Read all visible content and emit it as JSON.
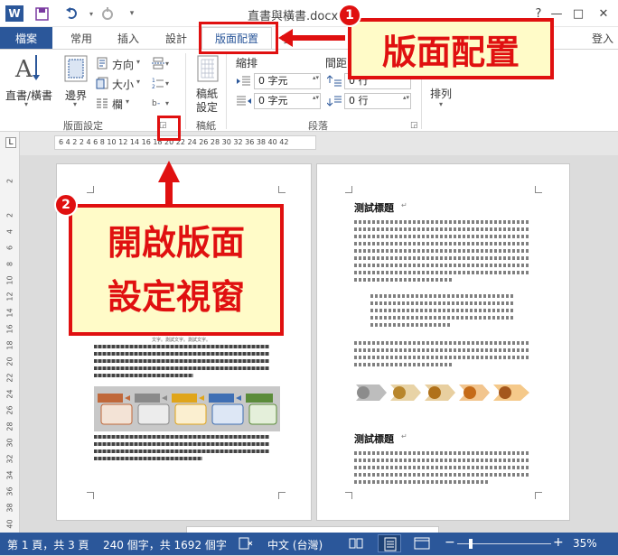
{
  "titlebar": {
    "doc_title": "直書與橫書.docx -",
    "app_icon": "W",
    "save_icon": "save-icon",
    "undo_icon": "undo-icon",
    "redo_icon": "redo-icon",
    "customize_icon": "customize-qat-icon",
    "help_label": "?",
    "restore_label": "▭",
    "minimize_label": "—",
    "maximize_label": "□",
    "close_label": "✕"
  },
  "tabs": {
    "file": "檔案",
    "home": "常用",
    "insert": "插入",
    "design": "設計",
    "layout": "版面配置",
    "references_partial": "參",
    "signin": "登入"
  },
  "ribbon": {
    "text_direction": "直書/橫書",
    "margins": "邊界",
    "orientation": "方向",
    "size": "大小",
    "columns": "欄",
    "page_setup_group": "版面設定",
    "indent_label": "縮排",
    "spacing_label": "間距",
    "indent_left": "0 字元",
    "indent_right": "0 字元",
    "spacing_before": "0 行",
    "spacing_after": "0 行",
    "paragraph_group": "段落",
    "arrange": "排列",
    "manuscript_line1": "稿紙",
    "manuscript_line2": "設定",
    "manuscript_group": "稿紙"
  },
  "ruler": {
    "horizontal_ticks": "6 4 2   2 4 6 8 10 12 14 16 18 20 22 24 26 28 30 32   36 38 40 42",
    "vertical_ticks": [
      "2",
      "2",
      "4",
      "6",
      "8",
      "10",
      "12",
      "14",
      "16",
      "18",
      "20",
      "22",
      "24",
      "26",
      "28",
      "30",
      "32",
      "34",
      "36",
      "38",
      "40",
      "42"
    ],
    "tab_selector": "L"
  },
  "document": {
    "page2_heading1": "测試標題",
    "page2_heading2": "测試標題",
    "page1_partial_line": "文字。測試文字。測試文字。",
    "para_mark": "↵"
  },
  "status": {
    "page": "第 1 頁，共 3 頁",
    "words": "240 個字，共 1692 個字",
    "language": "中文 (台灣)",
    "zoom": "35%",
    "zoom_minus": "−",
    "zoom_plus": "+"
  },
  "callouts": {
    "layout_callout": "版面配置",
    "dialog_callout_line1": "開啟版面",
    "dialog_callout_line2": "設定視窗",
    "badge1": "1",
    "badge2": "2"
  },
  "colors": {
    "accent": "#2b579a",
    "callout_red": "#e01010",
    "callout_fill": "#fffbc8"
  }
}
